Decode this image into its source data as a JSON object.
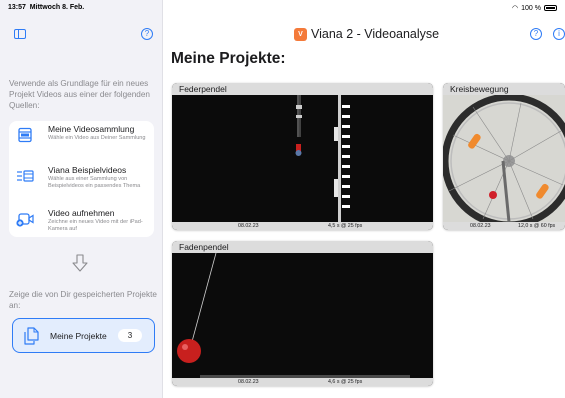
{
  "status_bar": {
    "time": "13:57",
    "date": "Mittwoch 8. Feb.",
    "battery": "100 %"
  },
  "sidebar": {
    "toggle_icon": "sidebar-icon",
    "help_icon": "question-circle-icon",
    "intro": "Verwende als Grundlage für ein neues Projekt Videos aus einer der folgenden Quellen:",
    "sources": [
      {
        "title": "Meine Videosammlung",
        "description": "Wähle ein Video aus Deiner Sammlung",
        "icon": "film-icon"
      },
      {
        "title": "Viana Beispielvideos",
        "description": "Wähle aus einer Sammlung von Beispielvideos ein passendes Thema",
        "icon": "list-film-icon"
      },
      {
        "title": "Video aufnehmen",
        "description": "Zeichne ein neues Video mit der iPad-Kamera auf",
        "icon": "video-camera-icon"
      }
    ],
    "arrow_icon": "arrow-down-icon",
    "saved_intro": "Zeige die von Dir gespeicherten Projekte an:",
    "projects_button": {
      "label": "Meine Projekte",
      "count": "3",
      "icon": "documents-icon"
    }
  },
  "header": {
    "app_title": "Viana 2 - Videoanalyse",
    "logo_icon": "viana-app-icon",
    "help_icon": "question-circle-icon",
    "info_icon": "info-circle-icon"
  },
  "main": {
    "title": "Meine Projekte:",
    "projects": [
      {
        "title": "Federpendel",
        "date": "08.02.23",
        "meta": "4,5 s @ 25 fps"
      },
      {
        "title": "Kreisbewegung",
        "date": "08.02.23",
        "meta": "12,0 s @ 60 fps"
      },
      {
        "title": "Fadenpendel",
        "date": "08.02.23",
        "meta": "4,6 s @ 25 fps"
      }
    ]
  },
  "colors": {
    "accent": "#2f7cf6",
    "sidebar_bg": "#f2f2f7",
    "selected_bg": "#e3edfd",
    "logo": "#f47a3a",
    "pendulum_ball": "#c8201e"
  }
}
